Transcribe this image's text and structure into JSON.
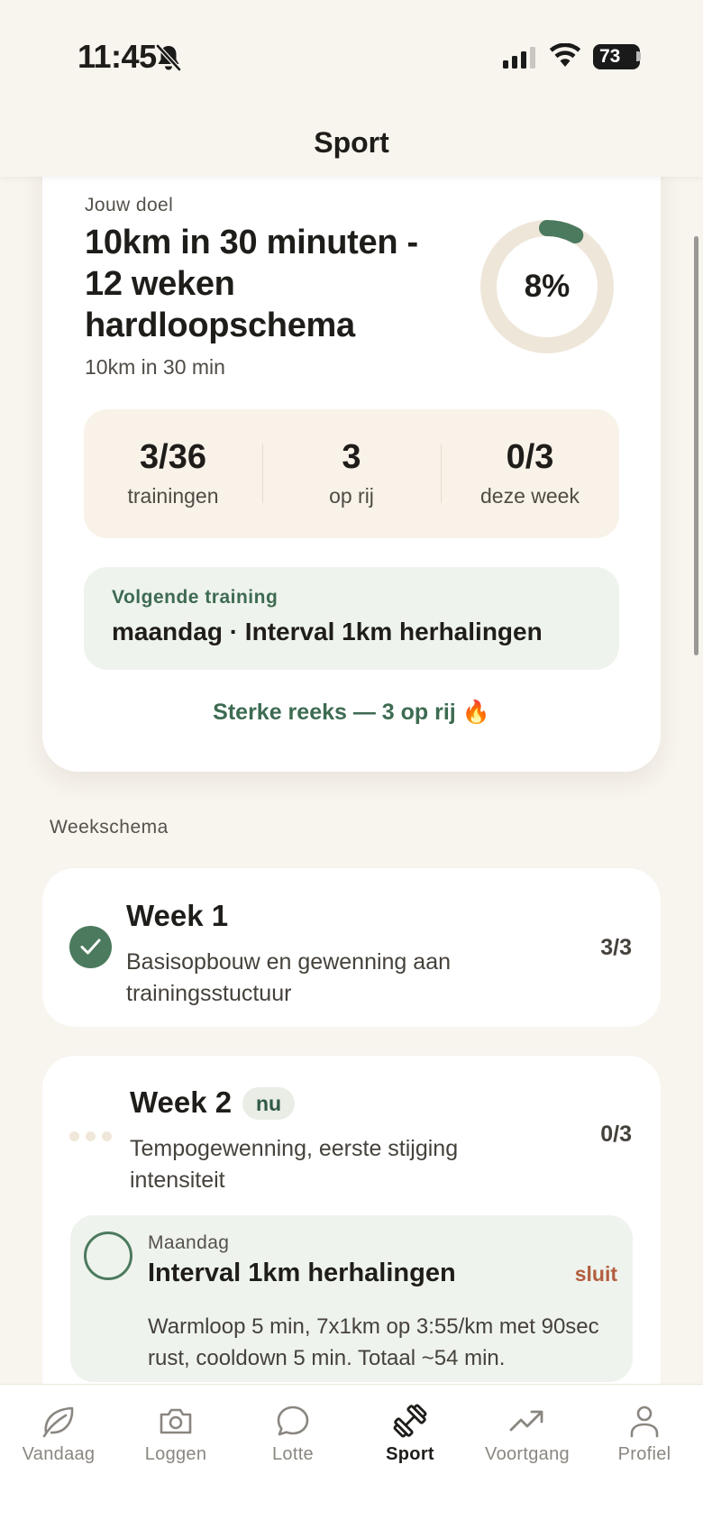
{
  "status_bar": {
    "time": "11:45",
    "battery": "73"
  },
  "header": {
    "title": "Sport"
  },
  "goal": {
    "label": "Jouw doel",
    "title": "10km in 30 minuten - 12 weken hardloopschema",
    "subtitle": "10km in 30 min",
    "progress_text": "8%",
    "progress_fraction": 0.08,
    "colors": {
      "ring_track": "#eee6d9",
      "ring_fill": "#4c7a5f"
    },
    "stats": [
      {
        "value": "3/36",
        "label": "trainingen"
      },
      {
        "value": "3",
        "label": "op rij"
      },
      {
        "value": "0/3",
        "label": "deze week"
      }
    ],
    "next_training": {
      "label": "Volgende training",
      "value": "maandag · Interval 1km herhalingen"
    },
    "streak": "Sterke reeks — 3 op rij 🔥"
  },
  "schedule": {
    "section_label": "Weekschema",
    "weeks": [
      {
        "title": "Week 1",
        "description": "Basisopbouw en gewenning aan trainingsstuctuur",
        "count": "3/3",
        "status": "completed"
      },
      {
        "title": "Week 2",
        "badge": "nu",
        "description": "Tempogewenning, eerste stijging intensiteit",
        "count": "0/3",
        "status": "current",
        "session": {
          "day": "Maandag",
          "title": "Interval 1km herhalingen",
          "action": "sluit",
          "description": "Warmloop 5 min, 7x1km op 3:55/km met 90sec rust, cooldown 5 min. Totaal ~54 min."
        }
      }
    ]
  },
  "tab_bar": {
    "active": "Sport",
    "tabs": [
      {
        "label": "Vandaag",
        "icon": "leaf-icon"
      },
      {
        "label": "Loggen",
        "icon": "camera-icon"
      },
      {
        "label": "Lotte",
        "icon": "chat-bubble-icon"
      },
      {
        "label": "Sport",
        "icon": "dumbbell-icon"
      },
      {
        "label": "Voortgang",
        "icon": "trending-up-icon"
      },
      {
        "label": "Profiel",
        "icon": "person-icon"
      }
    ]
  }
}
